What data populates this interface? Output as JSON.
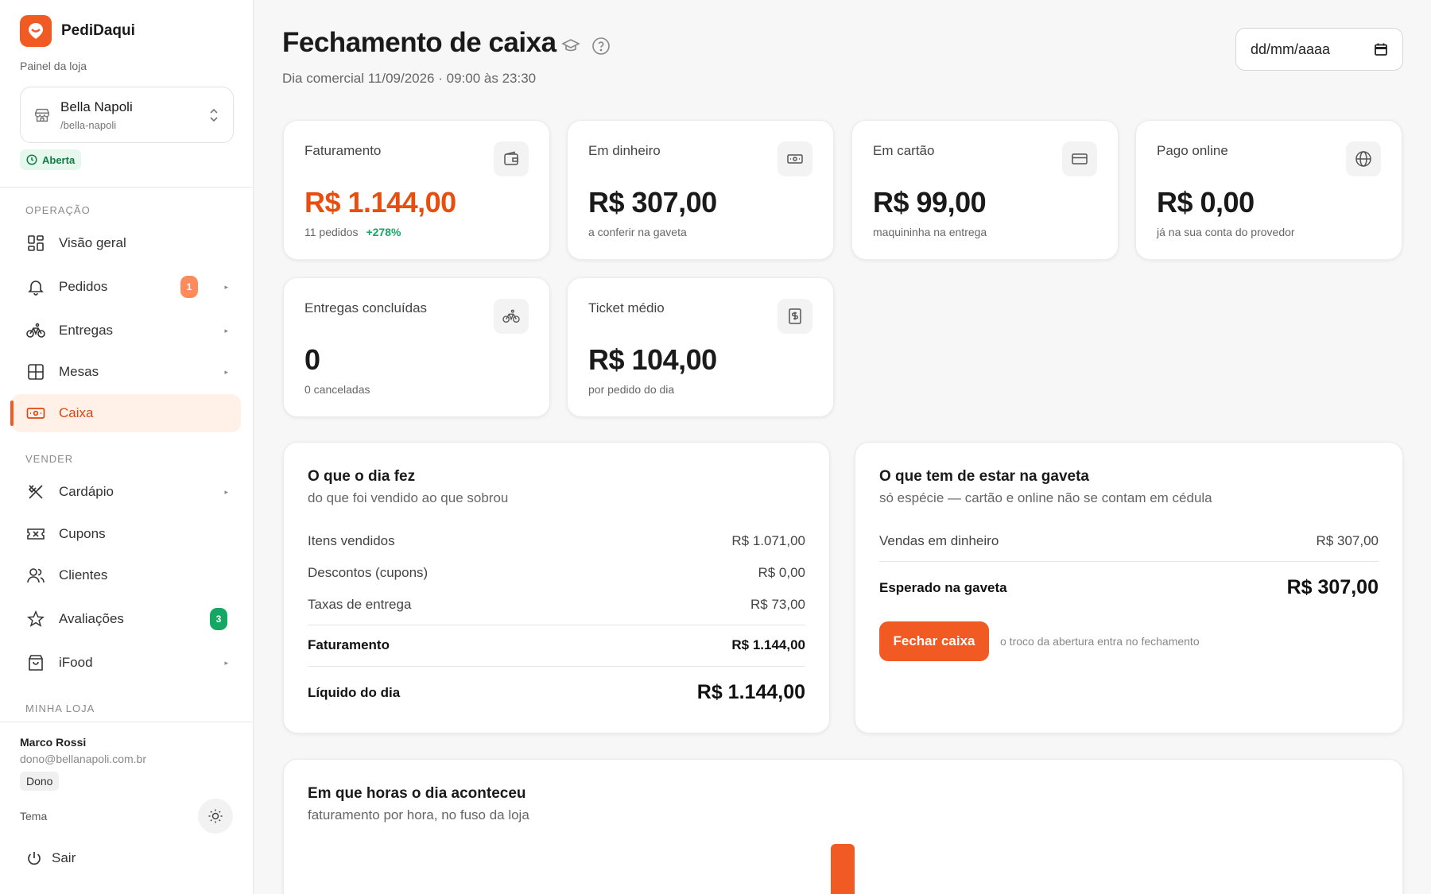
{
  "brand": {
    "name": "PediDaqui",
    "panel_label": "Painel da loja"
  },
  "store": {
    "name": "Bella Napoli",
    "slug": "/bella-napoli",
    "status": "Aberta"
  },
  "nav": {
    "section_operacao": "OPERAÇÃO",
    "section_vender": "VENDER",
    "section_minha_loja": "MINHA LOJA",
    "items": [
      {
        "label": "Visão geral"
      },
      {
        "label": "Pedidos",
        "badge": "1"
      },
      {
        "label": "Entregas"
      },
      {
        "label": "Mesas"
      },
      {
        "label": "Caixa"
      },
      {
        "label": "Cardápio"
      },
      {
        "label": "Cupons"
      },
      {
        "label": "Clientes"
      },
      {
        "label": "Avaliações",
        "badge": "3"
      },
      {
        "label": "iFood"
      }
    ]
  },
  "user": {
    "name": "Marco Rossi",
    "email": "dono@bellanapoli.com.br",
    "role": "Dono",
    "theme_label": "Tema",
    "logout_label": "Sair"
  },
  "header": {
    "title": "Fechamento de caixa",
    "subtitle": "Dia comercial 11/09/2026 · 09:00 às 23:30",
    "date_placeholder": "dd/mm/aaaa"
  },
  "kpis": [
    {
      "label": "Faturamento",
      "value": "R$ 1.144,00",
      "sub": "11 pedidos",
      "growth": "+278%",
      "icon": "wallet-icon"
    },
    {
      "label": "Em dinheiro",
      "value": "R$ 307,00",
      "sub": "a conferir na gaveta",
      "icon": "banknote-icon"
    },
    {
      "label": "Em cartão",
      "value": "R$ 99,00",
      "sub": "maquininha na entrega",
      "icon": "credit-card-icon"
    },
    {
      "label": "Pago online",
      "value": "R$ 0,00",
      "sub": "já na sua conta do provedor",
      "icon": "globe-icon"
    },
    {
      "label": "Entregas concluídas",
      "value": "0",
      "sub": "0 canceladas",
      "icon": "bike-icon"
    },
    {
      "label": "Ticket médio",
      "value": "R$ 104,00",
      "sub": "por pedido do dia",
      "icon": "receipt-icon"
    }
  ],
  "day_summary": {
    "title": "O que o dia fez",
    "subtitle": "do que foi vendido ao que sobrou",
    "rows": [
      {
        "label": "Itens vendidos",
        "value": "R$ 1.071,00"
      },
      {
        "label": "Descontos (cupons)",
        "value": "R$ 0,00"
      },
      {
        "label": "Taxas de entrega",
        "value": "R$ 73,00"
      }
    ],
    "total_label": "Faturamento",
    "total_value": "R$ 1.144,00",
    "net_label": "Líquido do dia",
    "net_value": "R$ 1.144,00"
  },
  "drawer": {
    "title": "O que tem de estar na gaveta",
    "subtitle": "só espécie — cartão e online não se contam em cédula",
    "row_label": "Vendas em dinheiro",
    "row_value": "R$ 307,00",
    "expected_label": "Esperado na gaveta",
    "expected_value": "R$ 307,00",
    "button_label": "Fechar caixa",
    "note": "o troco da abertura entra no fechamento"
  },
  "hours": {
    "title": "Em que horas o dia aconteceu",
    "subtitle": "faturamento por hora, no fuso da loja"
  },
  "colors": {
    "accent": "#f15a22",
    "success": "#16a765",
    "background": "#f7f7f7"
  }
}
